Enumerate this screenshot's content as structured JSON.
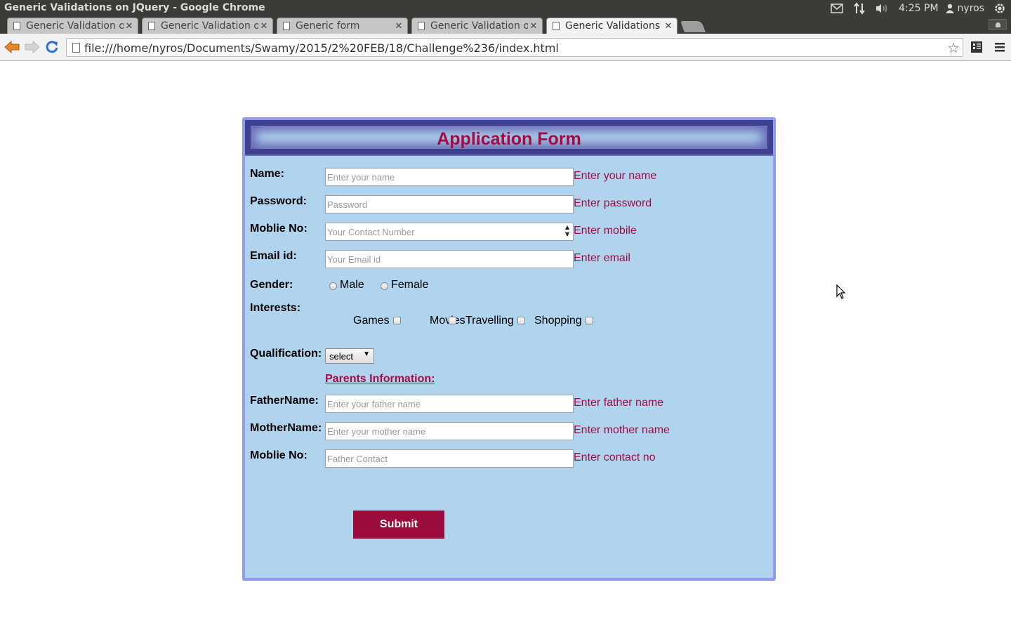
{
  "os": {
    "window_title": "Generic Validations on JQuery - Google Chrome",
    "time": "4:25 PM",
    "user": "nyros"
  },
  "tabs": [
    {
      "title": "Generic Validation o",
      "active": false
    },
    {
      "title": "Generic Validation o",
      "active": false
    },
    {
      "title": "Generic form",
      "active": false
    },
    {
      "title": "Generic Validation o",
      "active": false
    },
    {
      "title": "Generic Validations",
      "active": true
    }
  ],
  "browser": {
    "url": "file:///home/nyros/Documents/Swamy/2015/2%20FEB/18/Challenge%236/index.html"
  },
  "form": {
    "title": "Application Form",
    "fields": {
      "name": {
        "label": "Name:",
        "placeholder": "Enter your name",
        "hint": "Enter your name"
      },
      "password": {
        "label": "Password:",
        "placeholder": "Password",
        "hint": "Enter password"
      },
      "mobile": {
        "label": "Moblie No:",
        "placeholder": "Your Contact Number",
        "hint": "Enter mobile"
      },
      "email": {
        "label": "Email id:",
        "placeholder": "Your Email id",
        "hint": "Enter email"
      }
    },
    "gender": {
      "label": "Gender:",
      "options": [
        "Male",
        "Female"
      ]
    },
    "interests": {
      "label": "Interests:",
      "options": [
        "Games",
        "Movies",
        "Travelling",
        "Shopping"
      ]
    },
    "qualification": {
      "label": "Qualification:",
      "selected": "select"
    },
    "parents": {
      "heading": "Parents Information:",
      "father": {
        "label": "FatherName:",
        "placeholder": "Enter your father name",
        "hint": "Enter father name"
      },
      "mother": {
        "label": "MotherName:",
        "placeholder": "Enter your mother name",
        "hint": "Enter mother name"
      },
      "contact": {
        "label": "Moblie No:",
        "placeholder": "Father Contact",
        "hint": "Enter contact no"
      }
    },
    "submit_label": "Submit"
  }
}
